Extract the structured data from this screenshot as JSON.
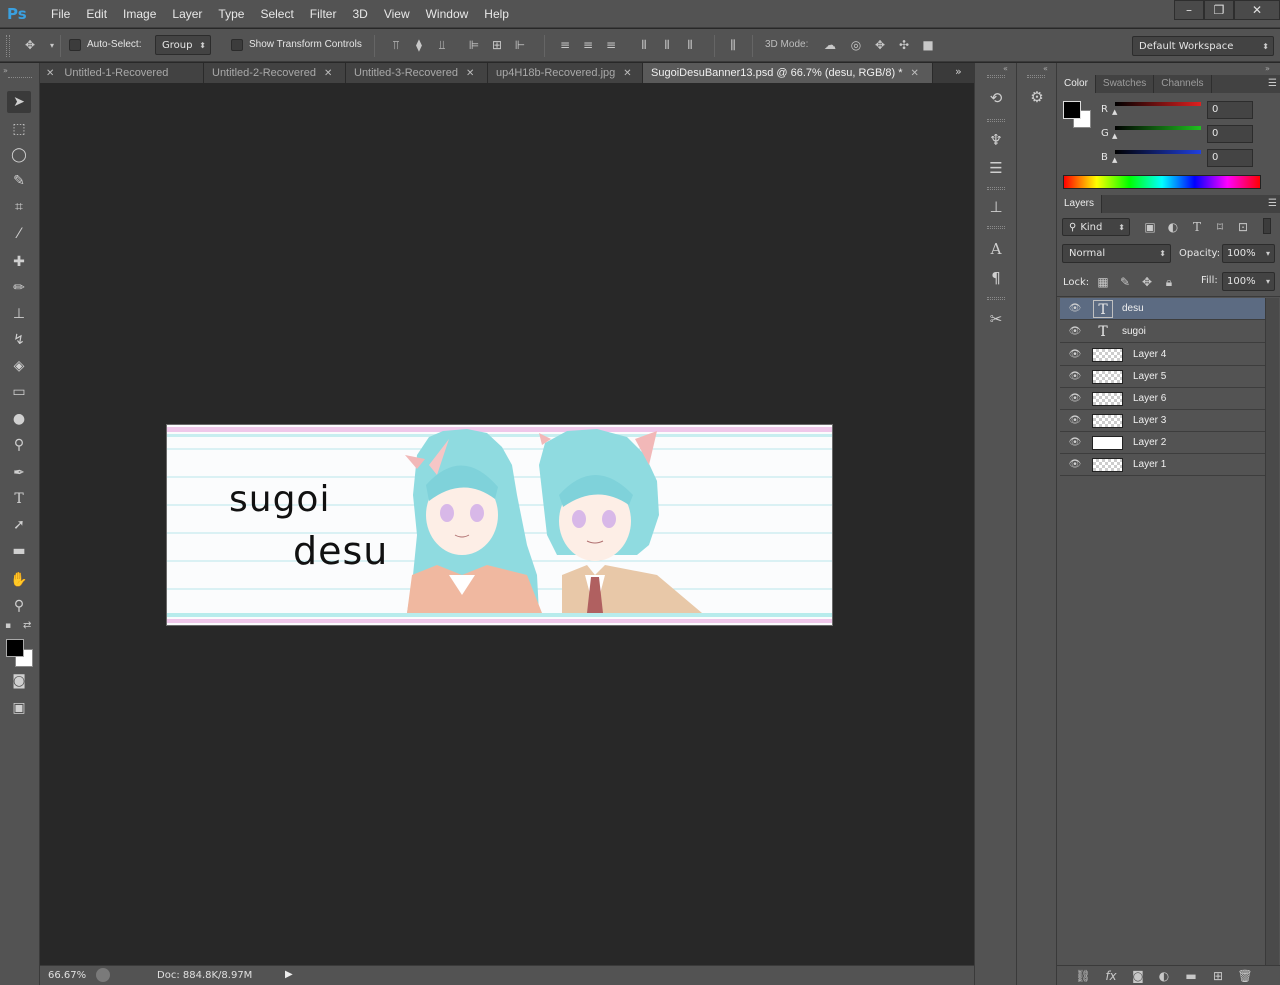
{
  "app": {
    "logo": "Ps"
  },
  "menu": [
    "File",
    "Edit",
    "Image",
    "Layer",
    "Type",
    "Select",
    "Filter",
    "3D",
    "View",
    "Window",
    "Help"
  ],
  "window_controls": {
    "minimize": "–",
    "restore": "❐",
    "close": "✕"
  },
  "options_bar": {
    "auto_select_label": "Auto-Select:",
    "auto_select_value": "Group",
    "transform_label": "Show Transform Controls",
    "mode_3d_label": "3D Mode:",
    "workspace": "Default Workspace"
  },
  "tabs": [
    {
      "label": "Untitled-1-Recovered",
      "active": false
    },
    {
      "label": "Untitled-2-Recovered",
      "active": false
    },
    {
      "label": "Untitled-3-Recovered",
      "active": false
    },
    {
      "label": "up4H18b-Recovered.jpg",
      "active": false
    },
    {
      "label": "SugoiDesuBanner13.psd @ 66.7% (desu, RGB/8) *",
      "active": true
    }
  ],
  "banner": {
    "text_line1": "sugoi",
    "text_line2": "desu"
  },
  "status": {
    "zoom": "66.67%",
    "doc": "Doc: 884.8K/8.97M"
  },
  "color_panel": {
    "tabs": [
      "Color",
      "Swatches",
      "Channels"
    ],
    "channels": [
      {
        "label": "R",
        "value": "0",
        "color": "#e02020"
      },
      {
        "label": "G",
        "value": "0",
        "color": "#20c020"
      },
      {
        "label": "B",
        "value": "0",
        "color": "#2040e0"
      }
    ]
  },
  "layers_panel": {
    "title": "Layers",
    "filter_kind": "Kind",
    "blend_mode": "Normal",
    "opacity_label": "Opacity:",
    "opacity_value": "100%",
    "lock_label": "Lock:",
    "fill_label": "Fill:",
    "fill_value": "100%",
    "layers": [
      {
        "name": "desu",
        "type": "text",
        "selected": true
      },
      {
        "name": "sugoi",
        "type": "text",
        "selected": false
      },
      {
        "name": "Layer 4",
        "type": "raster",
        "selected": false
      },
      {
        "name": "Layer 5",
        "type": "raster",
        "selected": false
      },
      {
        "name": "Layer 6",
        "type": "raster",
        "selected": false
      },
      {
        "name": "Layer 3",
        "type": "raster",
        "selected": false
      },
      {
        "name": "Layer 2",
        "type": "white",
        "selected": false
      },
      {
        "name": "Layer 1",
        "type": "raster",
        "selected": false
      }
    ]
  }
}
